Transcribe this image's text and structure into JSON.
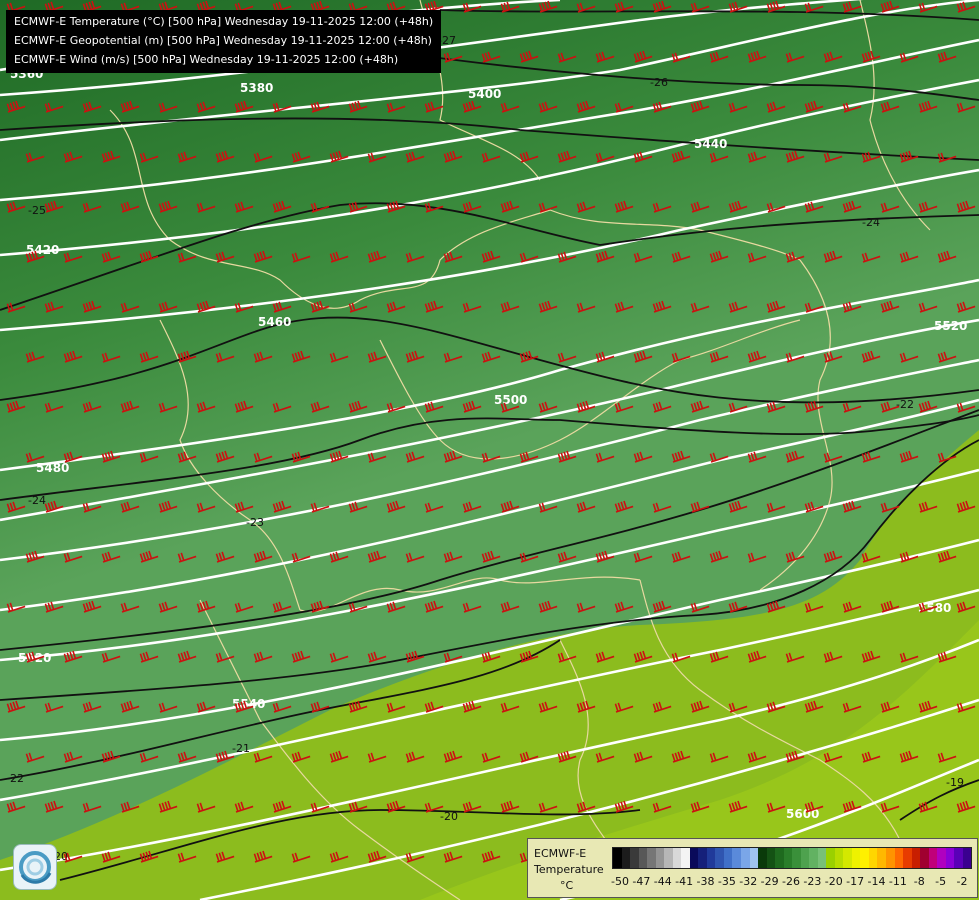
{
  "header": {
    "line1": "ECMWF-E Temperature (°C) [500 hPa] Wednesday 19-11-2025 12:00 (+48h)",
    "line2": "ECMWF-E Geopotential (m) [500 hPa] Wednesday 19-11-2025 12:00 (+48h)",
    "line3": "ECMWF-E Wind (m/s) [500 hPa] Wednesday 19-11-2025 12:00 (+48h)"
  },
  "geopotential_labels": [
    "5360",
    "5380",
    "5400",
    "5420",
    "5440",
    "5460",
    "5480",
    "5500",
    "5520",
    "5520",
    "5540",
    "5580",
    "5600"
  ],
  "temperature_labels": [
    "-27",
    "-26",
    "-25",
    "-24",
    "-24",
    "-23",
    "-22",
    "-22",
    "-21",
    "-20",
    "-19",
    "-20"
  ],
  "legend": {
    "title_line1": "ECMWF-E",
    "title_line2": "Temperature",
    "unit": "°C",
    "tick_labels": [
      "-50",
      "-47",
      "-44",
      "-41",
      "-38",
      "-35",
      "-32",
      "-29",
      "-26",
      "-23",
      "-20",
      "-17",
      "-14",
      "-11",
      "-8",
      "-5",
      "-2"
    ],
    "colors": [
      "#000000",
      "#1c1c1c",
      "#3a3a3a",
      "#585858",
      "#767676",
      "#949494",
      "#b6b6b6",
      "#d8d8d8",
      "#f4f4f4",
      "#0a0a5a",
      "#15207a",
      "#203a9a",
      "#2f55b0",
      "#4070c8",
      "#5a8ada",
      "#7aa6e8",
      "#a0c4f0",
      "#0a3a0a",
      "#145214",
      "#1e6a1e",
      "#2a7e2a",
      "#3a903a",
      "#4ea24e",
      "#62b262",
      "#78c078",
      "#9ad000",
      "#b8dc00",
      "#d4e800",
      "#eef200",
      "#fff000",
      "#ffd600",
      "#ffb800",
      "#ff9400",
      "#ff6a00",
      "#e83c00",
      "#c81e00",
      "#a00030",
      "#c0007a",
      "#b000c0",
      "#8a00d6",
      "#5a00b8",
      "#3a0090"
    ]
  },
  "colors": {
    "contour_geopotential": "#ffffff",
    "contour_temperature": "#000000",
    "wind_barbs": "#cc1111",
    "borders": "#e8d9a0"
  }
}
